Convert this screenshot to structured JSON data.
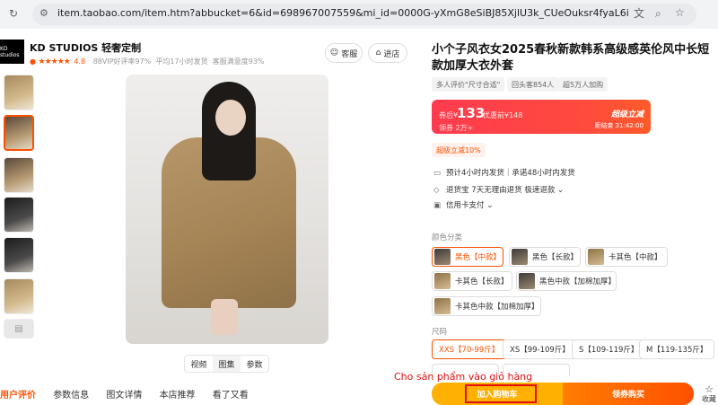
{
  "browser": {
    "url": "item.taobao.com/item.htm?abbucket=6&id=698967007559&mi_id=0000G-yXmG8eSiBJ85XjlU3k_CUeOuksr4fyaL6iwYZunMY&ns=1&priceTId=..."
  },
  "store": {
    "logo_text": "KD studios",
    "name": "KD STUDIOS 轻奢定制",
    "stars": "★★★★★",
    "rating": "4.8",
    "stat1": "88VIP好评率97%",
    "stat2": "平均17小时发货",
    "stat3": "客服满意度93%",
    "service_label": "客服",
    "enter_label": "进店"
  },
  "gallery": {
    "mini_tabs": [
      "视频",
      "图集",
      "参数"
    ]
  },
  "bottom_tabs": [
    "用户评价",
    "参数信息",
    "图文详情",
    "本店推荐",
    "看了又看"
  ],
  "product": {
    "title": "小个子风衣女2025春秋新款韩系高级感英伦风中长短款加厚大衣外套",
    "tags": [
      "多人评价\"尺寸合适\"",
      "回头客854人",
      "超5万人加购"
    ],
    "price": {
      "prefix": "券后¥",
      "amount": "133",
      "discount": "优惠前¥148",
      "sub": "领券 2万+",
      "cta": "超级立减",
      "timer": "距结束 31:42:00"
    },
    "promo": "超级立减10%",
    "services": [
      {
        "icon": "truck-icon",
        "text": "预计4小时内发货｜承诺48小时内发货"
      },
      {
        "icon": "shield-icon",
        "text": "退货宝    7天无理由退货    极速退款 ⌄"
      },
      {
        "icon": "card-icon",
        "text": "信用卡支付 ⌄"
      }
    ],
    "color_label": "颜色分类",
    "colors": [
      "黑色【中款】",
      "黑色【长款】",
      "卡其色【中款】",
      "卡其色【长款】",
      "黑色中款【加棉加厚】",
      "卡其色中款【加棉加厚】"
    ],
    "size_label": "尺码",
    "sizes": [
      "XXS【70-99斤】",
      "XS【99-109斤】",
      "S【109-119斤】",
      "M【119-135斤】"
    ]
  },
  "actions": {
    "add_to_cart": "加入购物车",
    "buy_now": "领券购买",
    "favorite": "收藏"
  },
  "annotation": "Cho sản phẩm vào giỏ hàng"
}
